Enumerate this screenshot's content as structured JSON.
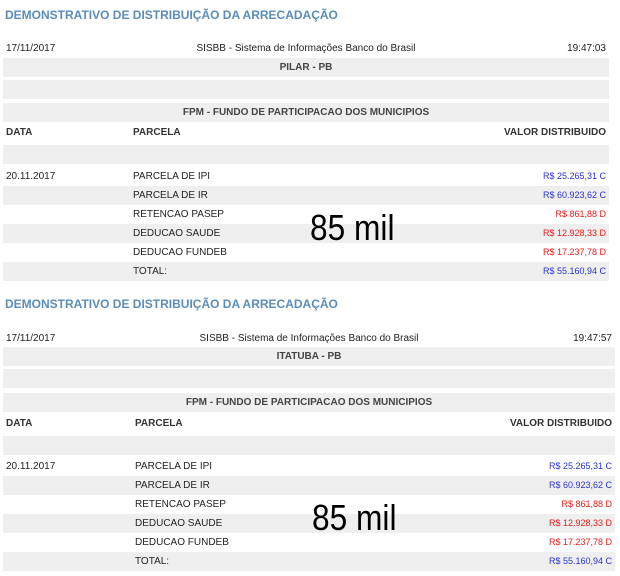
{
  "reports": [
    {
      "title": "DEMONSTRATIVO DE DISTRIBUIÇÃO DA ARRECADAÇÃO",
      "date": "17/11/2017",
      "system": "SISBB - Sistema de Informações Banco do Brasil",
      "time": "19:47:03",
      "municipality": "PILAR - PB",
      "fund": "FPM - FUNDO DE PARTICIPACAO DOS MUNICIPIOS",
      "col_data": "DATA",
      "col_parcela": "PARCELA",
      "col_valor": "VALOR DISTRIBUIDO",
      "row_date": "20.11.2017",
      "rows": [
        {
          "label": "PARCELA DE IPI",
          "value": "R$ 25.265,31 C",
          "type": "credit"
        },
        {
          "label": "PARCELA DE IR",
          "value": "R$ 60.923,62 C",
          "type": "credit"
        },
        {
          "label": "RETENCAO PASEP",
          "value": "R$ 861,88 D",
          "type": "debit"
        },
        {
          "label": "DEDUCAO SAUDE",
          "value": "R$ 12.928,33 D",
          "type": "debit"
        },
        {
          "label": "DEDUCAO FUNDEB",
          "value": "R$ 17.237,78 D",
          "type": "debit"
        },
        {
          "label": "TOTAL:",
          "value": "R$ 55.160,94 C",
          "type": "credit"
        }
      ],
      "overlay": "85 mil"
    },
    {
      "title": "DEMONSTRATIVO DE DISTRIBUIÇÃO DA ARRECADAÇÃO",
      "date": "17/11/2017",
      "system": "SISBB - Sistema de Informações Banco do Brasil",
      "time": "19:47:57",
      "municipality": "ITATUBA - PB",
      "fund": "FPM - FUNDO DE PARTICIPACAO DOS MUNICIPIOS",
      "col_data": "DATA",
      "col_parcela": "PARCELA",
      "col_valor": "VALOR DISTRIBUIDO",
      "row_date": "20.11.2017",
      "rows": [
        {
          "label": "PARCELA DE IPI",
          "value": "R$ 25.265,31 C",
          "type": "credit"
        },
        {
          "label": "PARCELA DE IR",
          "value": "R$ 60.923,62 C",
          "type": "credit"
        },
        {
          "label": "RETENCAO PASEP",
          "value": "R$ 861,88 D",
          "type": "debit"
        },
        {
          "label": "DEDUCAO SAUDE",
          "value": "R$ 12.928,33 D",
          "type": "debit"
        },
        {
          "label": "DEDUCAO FUNDEB",
          "value": "R$ 17.237,78 D",
          "type": "debit"
        },
        {
          "label": "TOTAL:",
          "value": "R$ 55.160,94 C",
          "type": "credit"
        }
      ],
      "overlay": "85 mil"
    }
  ],
  "colors": {
    "title": "#5b8db8",
    "credit": "#2a35c9",
    "debit": "#e0201e",
    "shade": "#efefef"
  }
}
